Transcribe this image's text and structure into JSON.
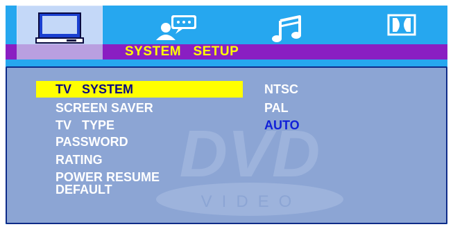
{
  "tabs": [
    {
      "name": "system",
      "icon": "tv-monitor-icon",
      "active": true
    },
    {
      "name": "language",
      "icon": "person-speech-icon",
      "active": false
    },
    {
      "name": "audio",
      "icon": "music-note-icon",
      "active": false
    },
    {
      "name": "dolby",
      "icon": "dolby-icon",
      "active": false
    }
  ],
  "header": {
    "title": "SYSTEM   SETUP"
  },
  "menu": {
    "items": [
      {
        "label": "TV   SYSTEM",
        "selected": true
      },
      {
        "label": "SCREEN SAVER",
        "selected": false
      },
      {
        "label": "TV   TYPE",
        "selected": false
      },
      {
        "label": "PASSWORD",
        "selected": false
      },
      {
        "label": "RATING",
        "selected": false
      },
      {
        "label": "POWER RESUME",
        "selected": false
      },
      {
        "label": "DEFAULT",
        "selected": false
      }
    ]
  },
  "options": {
    "items": [
      {
        "label": "NTSC",
        "current": false
      },
      {
        "label": "PAL",
        "current": false
      },
      {
        "label": "AUTO",
        "current": true
      }
    ]
  },
  "watermark": {
    "logo": "DVD",
    "sub": "VIDEO"
  },
  "colors": {
    "background": "#26a7ef",
    "title_bar": "#8a1ec2",
    "title_text": "#ffff00",
    "panel": "#8ca5d4",
    "highlight": "#ffff00",
    "current_option": "#1020d8"
  }
}
